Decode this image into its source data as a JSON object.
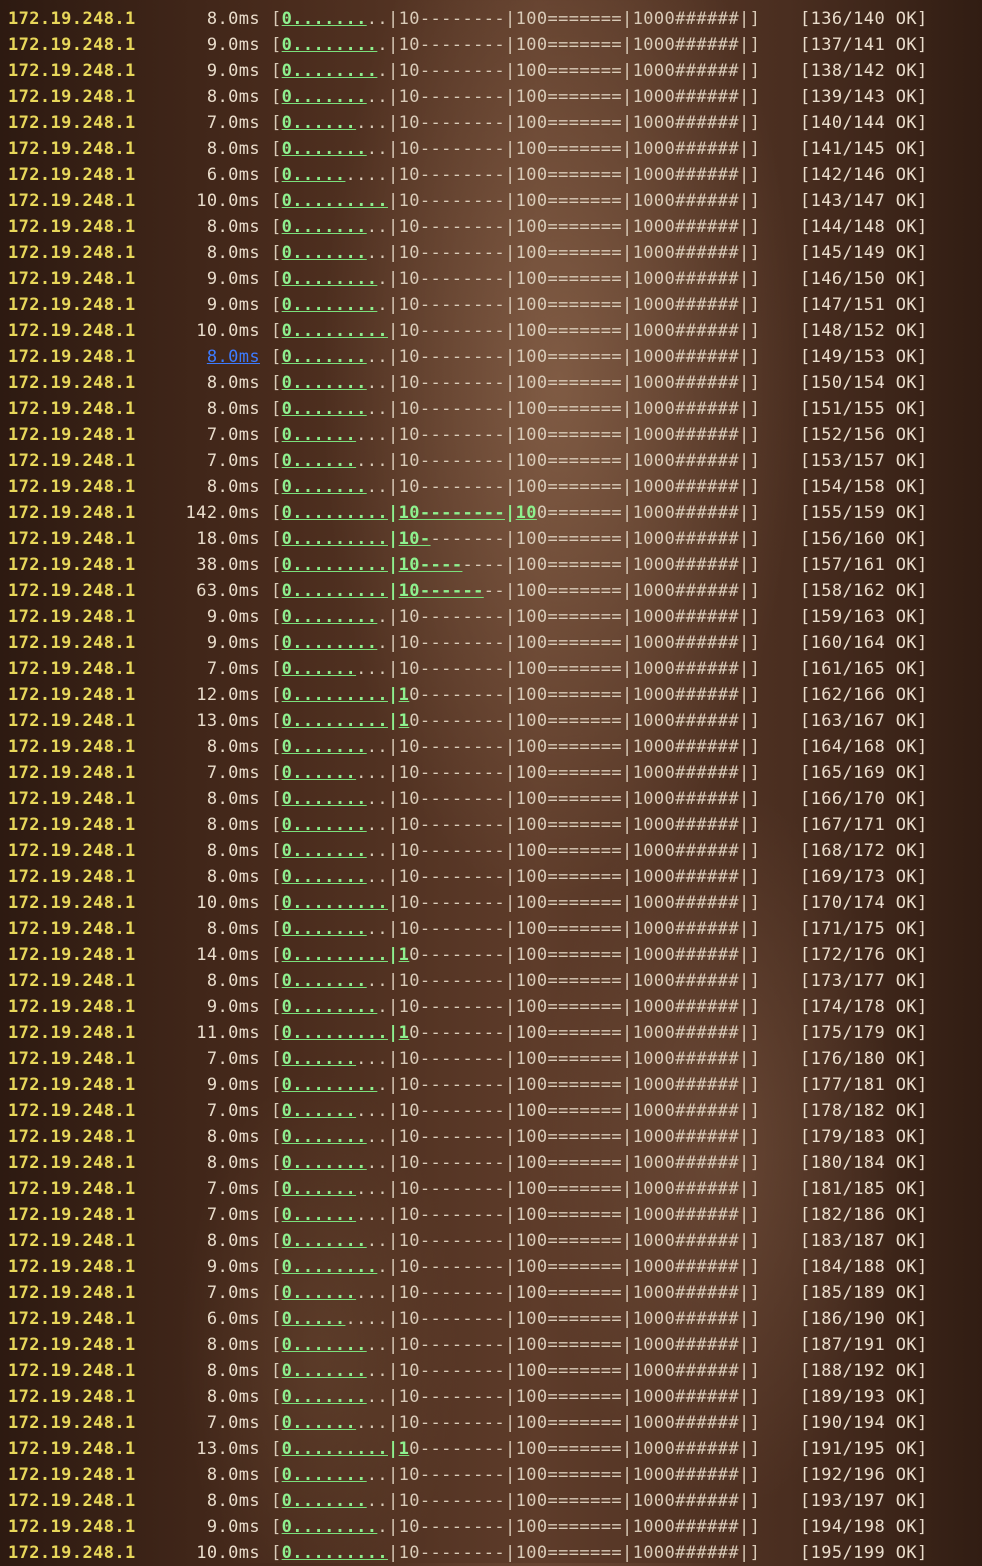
{
  "terminal": {
    "ip": "172.19.248.1",
    "scale_labels": [
      "0",
      "10",
      "100",
      "1000"
    ],
    "status": "OK",
    "colors": {
      "ip": "#e8d75a",
      "bar_fill": "#8ef08e",
      "text": "#e9dccb",
      "selected_latency": "#3d7bff"
    },
    "selected_row_index": 13,
    "rows": [
      {
        "latency": "8.0ms",
        "count": "[136/140 OK]"
      },
      {
        "latency": "9.0ms",
        "count": "[137/141 OK]"
      },
      {
        "latency": "9.0ms",
        "count": "[138/142 OK]"
      },
      {
        "latency": "8.0ms",
        "count": "[139/143 OK]"
      },
      {
        "latency": "7.0ms",
        "count": "[140/144 OK]"
      },
      {
        "latency": "8.0ms",
        "count": "[141/145 OK]"
      },
      {
        "latency": "6.0ms",
        "count": "[142/146 OK]"
      },
      {
        "latency": "10.0ms",
        "count": "[143/147 OK]"
      },
      {
        "latency": "8.0ms",
        "count": "[144/148 OK]"
      },
      {
        "latency": "8.0ms",
        "count": "[145/149 OK]"
      },
      {
        "latency": "9.0ms",
        "count": "[146/150 OK]"
      },
      {
        "latency": "9.0ms",
        "count": "[147/151 OK]"
      },
      {
        "latency": "10.0ms",
        "count": "[148/152 OK]"
      },
      {
        "latency": "8.0ms",
        "count": "[149/153 OK]"
      },
      {
        "latency": "8.0ms",
        "count": "[150/154 OK]"
      },
      {
        "latency": "8.0ms",
        "count": "[151/155 OK]"
      },
      {
        "latency": "7.0ms",
        "count": "[152/156 OK]"
      },
      {
        "latency": "7.0ms",
        "count": "[153/157 OK]"
      },
      {
        "latency": "8.0ms",
        "count": "[154/158 OK]"
      },
      {
        "latency": "142.0ms",
        "count": "[155/159 OK]"
      },
      {
        "latency": "18.0ms",
        "count": "[156/160 OK]"
      },
      {
        "latency": "38.0ms",
        "count": "[157/161 OK]"
      },
      {
        "latency": "63.0ms",
        "count": "[158/162 OK]"
      },
      {
        "latency": "9.0ms",
        "count": "[159/163 OK]"
      },
      {
        "latency": "9.0ms",
        "count": "[160/164 OK]"
      },
      {
        "latency": "7.0ms",
        "count": "[161/165 OK]"
      },
      {
        "latency": "12.0ms",
        "count": "[162/166 OK]"
      },
      {
        "latency": "13.0ms",
        "count": "[163/167 OK]"
      },
      {
        "latency": "8.0ms",
        "count": "[164/168 OK]"
      },
      {
        "latency": "7.0ms",
        "count": "[165/169 OK]"
      },
      {
        "latency": "8.0ms",
        "count": "[166/170 OK]"
      },
      {
        "latency": "8.0ms",
        "count": "[167/171 OK]"
      },
      {
        "latency": "8.0ms",
        "count": "[168/172 OK]"
      },
      {
        "latency": "8.0ms",
        "count": "[169/173 OK]"
      },
      {
        "latency": "10.0ms",
        "count": "[170/174 OK]"
      },
      {
        "latency": "8.0ms",
        "count": "[171/175 OK]"
      },
      {
        "latency": "14.0ms",
        "count": "[172/176 OK]"
      },
      {
        "latency": "8.0ms",
        "count": "[173/177 OK]"
      },
      {
        "latency": "9.0ms",
        "count": "[174/178 OK]"
      },
      {
        "latency": "11.0ms",
        "count": "[175/179 OK]"
      },
      {
        "latency": "7.0ms",
        "count": "[176/180 OK]"
      },
      {
        "latency": "9.0ms",
        "count": "[177/181 OK]"
      },
      {
        "latency": "7.0ms",
        "count": "[178/182 OK]"
      },
      {
        "latency": "8.0ms",
        "count": "[179/183 OK]"
      },
      {
        "latency": "8.0ms",
        "count": "[180/184 OK]"
      },
      {
        "latency": "7.0ms",
        "count": "[181/185 OK]"
      },
      {
        "latency": "7.0ms",
        "count": "[182/186 OK]"
      },
      {
        "latency": "8.0ms",
        "count": "[183/187 OK]"
      },
      {
        "latency": "9.0ms",
        "count": "[184/188 OK]"
      },
      {
        "latency": "7.0ms",
        "count": "[185/189 OK]"
      },
      {
        "latency": "6.0ms",
        "count": "[186/190 OK]"
      },
      {
        "latency": "8.0ms",
        "count": "[187/191 OK]"
      },
      {
        "latency": "8.0ms",
        "count": "[188/192 OK]"
      },
      {
        "latency": "8.0ms",
        "count": "[189/193 OK]"
      },
      {
        "latency": "7.0ms",
        "count": "[190/194 OK]"
      },
      {
        "latency": "13.0ms",
        "count": "[191/195 OK]"
      },
      {
        "latency": "8.0ms",
        "count": "[192/196 OK]"
      },
      {
        "latency": "8.0ms",
        "count": "[193/197 OK]"
      },
      {
        "latency": "9.0ms",
        "count": "[194/198 OK]"
      },
      {
        "latency": "10.0ms",
        "count": "[195/199 OK]"
      }
    ]
  }
}
